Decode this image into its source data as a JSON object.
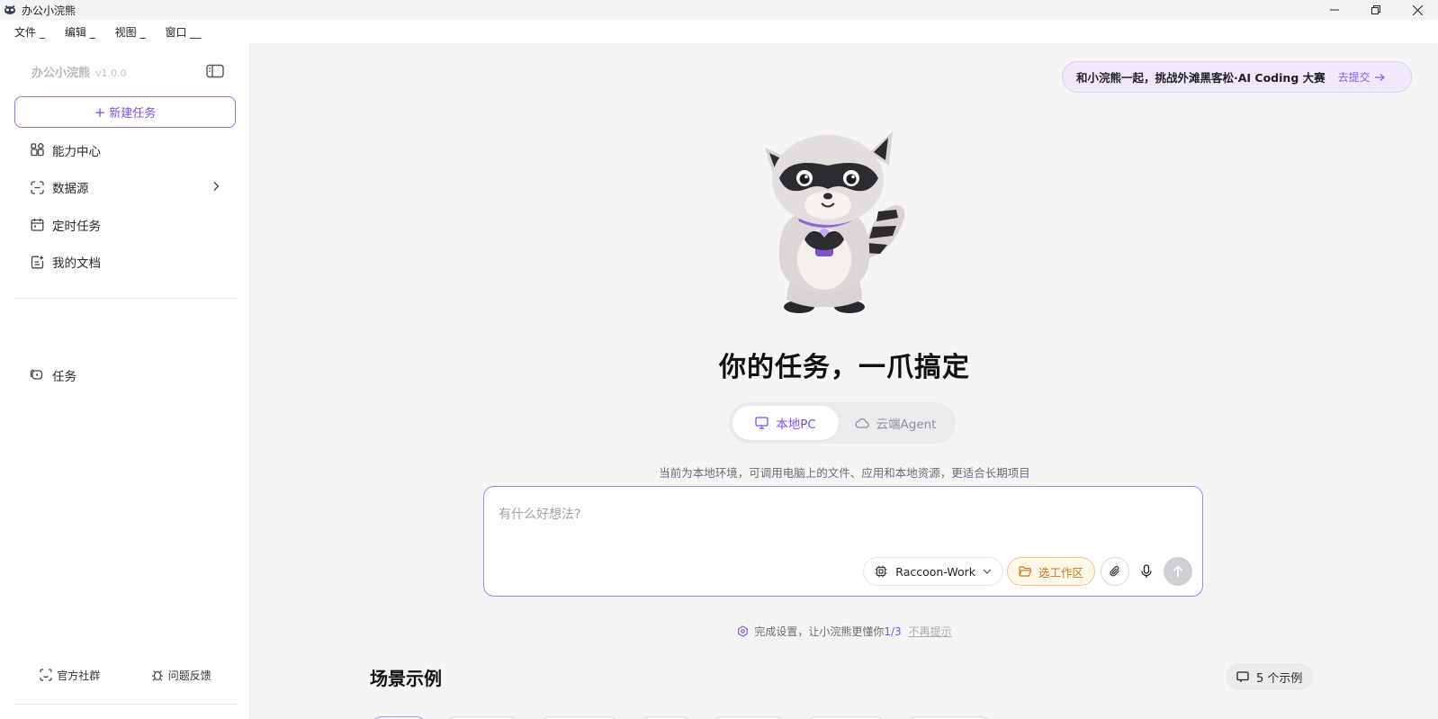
{
  "window": {
    "title": "办公小浣熊"
  },
  "menubar": {
    "items": [
      "文件 _",
      "编辑 _",
      "视图 _",
      "窗口 __"
    ]
  },
  "sidebar": {
    "app_name": "办公小浣熊",
    "version": "v1.0.0",
    "new_task_label": "新建任务",
    "nav": [
      {
        "label": "能力中心",
        "icon": "grid-icon"
      },
      {
        "label": "数据源",
        "icon": "scan-icon"
      },
      {
        "label": "定时任务",
        "icon": "calendar-icon"
      },
      {
        "label": "我的文档",
        "icon": "document-icon"
      }
    ],
    "tasks_label": "任务",
    "footer": {
      "community_label": "官方社群",
      "feedback_label": "问题反馈"
    }
  },
  "banner": {
    "text": "和小浣熊一起，挑战外滩黑客松·AI Coding 大赛",
    "link": "去提交"
  },
  "hero": {
    "title": "你的任务，一爪搞定"
  },
  "mode_switch": {
    "local_label": "本地PC",
    "cloud_label": "云端Agent",
    "selected": "本地PC"
  },
  "env_desc": "当前为本地环境，可调用电脑上的文件、应用和本地资源，更适合长期项目",
  "input": {
    "placeholder": "有什么好想法?",
    "model_label": "Raccoon-Work",
    "workspace_label": "选工作区"
  },
  "setup_hint": {
    "text": "完成设置，让小浣熊更懂你",
    "progress": "1/3",
    "dismiss": "不再提示"
  },
  "examples": {
    "title": "场景示例",
    "count_label": "5 个示例"
  },
  "colors": {
    "accent": "#7c4ee4",
    "workspace": "#c97a1a",
    "banner_bg": "#efe9fb"
  }
}
